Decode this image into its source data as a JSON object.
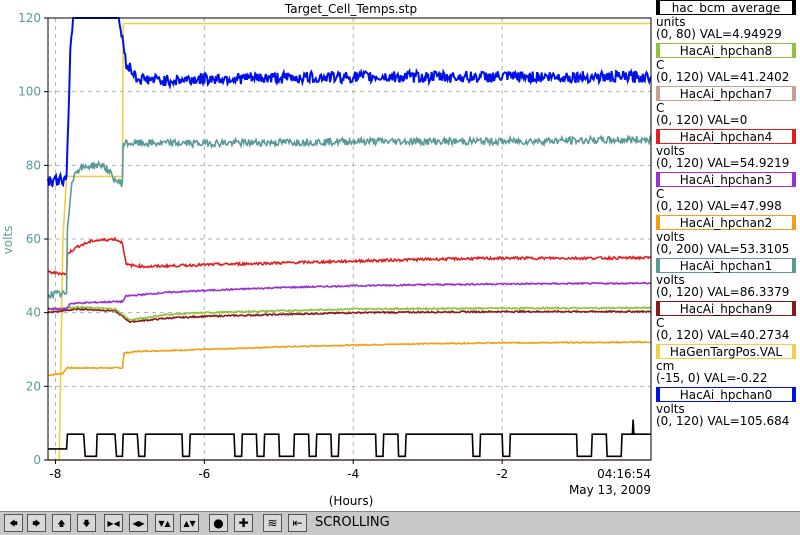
{
  "chart_data": {
    "type": "line",
    "title": "Target_Cell_Temps.stp",
    "xlabel": "(Hours)",
    "ylabel": "volts",
    "xlim": [
      -8.1,
      0.0
    ],
    "ylim": [
      0,
      120
    ],
    "x_ticks": [
      -8,
      -6,
      -4,
      -2
    ],
    "y_ticks": [
      0,
      20,
      40,
      60,
      80,
      100,
      120
    ],
    "grid": true,
    "time_label": "04:16:54",
    "date_label": "May 13, 2009",
    "series": [
      {
        "name": "hac_bcm_average",
        "color": "#000000",
        "unit": "units",
        "range": "(0, 80)",
        "value": "VAL=4.94929",
        "points": [
          [
            -8.1,
            3
          ],
          [
            -7.85,
            3
          ],
          [
            -7.84,
            7
          ],
          [
            -7.62,
            7
          ],
          [
            -7.6,
            1
          ],
          [
            -7.45,
            1
          ],
          [
            -7.44,
            7
          ],
          [
            -7.2,
            7
          ],
          [
            -7.18,
            1
          ],
          [
            -7.1,
            1
          ],
          [
            -7.09,
            7
          ],
          [
            -6.9,
            7
          ],
          [
            -6.88,
            1
          ],
          [
            -6.8,
            1
          ],
          [
            -6.79,
            7
          ],
          [
            -6.3,
            7
          ],
          [
            -6.29,
            1
          ],
          [
            -6.2,
            1
          ],
          [
            -6.19,
            7
          ],
          [
            -5.6,
            7
          ],
          [
            -5.59,
            1
          ],
          [
            -5.5,
            1
          ],
          [
            -5.49,
            7
          ],
          [
            -5.3,
            7
          ],
          [
            -5.29,
            1
          ],
          [
            -5.2,
            1
          ],
          [
            -5.19,
            7
          ],
          [
            -5.0,
            7
          ],
          [
            -4.99,
            1
          ],
          [
            -4.8,
            1
          ],
          [
            -4.79,
            7
          ],
          [
            -4.6,
            7
          ],
          [
            -4.59,
            1
          ],
          [
            -4.5,
            1
          ],
          [
            -4.49,
            7
          ],
          [
            -4.3,
            7
          ],
          [
            -4.29,
            1
          ],
          [
            -4.2,
            1
          ],
          [
            -4.19,
            7
          ],
          [
            -3.7,
            7
          ],
          [
            -3.69,
            1
          ],
          [
            -3.6,
            1
          ],
          [
            -3.59,
            7
          ],
          [
            -3.4,
            7
          ],
          [
            -3.39,
            1
          ],
          [
            -3.3,
            1
          ],
          [
            -3.29,
            7
          ],
          [
            -2.4,
            7
          ],
          [
            -2.39,
            1
          ],
          [
            -2.3,
            1
          ],
          [
            -2.29,
            7
          ],
          [
            -2.0,
            7
          ],
          [
            -1.99,
            1
          ],
          [
            -1.9,
            1
          ],
          [
            -1.89,
            7
          ],
          [
            -1.0,
            7
          ],
          [
            -0.99,
            1
          ],
          [
            -0.8,
            1
          ],
          [
            -0.79,
            7
          ],
          [
            -0.6,
            7
          ],
          [
            -0.59,
            1
          ],
          [
            -0.4,
            1
          ],
          [
            -0.39,
            7
          ],
          [
            -0.25,
            7
          ],
          [
            -0.24,
            11
          ],
          [
            -0.23,
            7
          ],
          [
            0.0,
            7
          ]
        ]
      },
      {
        "name": "HacAi_hpchan8",
        "color": "#8fc23a",
        "unit": "C",
        "range": "(0, 120)",
        "value": "VAL=41.2402",
        "points": [
          [
            -8.1,
            41
          ],
          [
            -7.7,
            41.5
          ],
          [
            -7.2,
            41
          ],
          [
            -7.0,
            38
          ],
          [
            -6.5,
            39.5
          ],
          [
            -6,
            40
          ],
          [
            -4,
            41
          ],
          [
            -2,
            41.2
          ],
          [
            0,
            41.3
          ]
        ]
      },
      {
        "name": "HacAi_hpchan7",
        "color": "#c9a090",
        "unit": "C",
        "range": "(0, 120)",
        "value": "VAL=0",
        "points": [
          [
            -8.1,
            0
          ],
          [
            0,
            0
          ]
        ]
      },
      {
        "name": "HacAi_hpchan4",
        "color": "#e02020",
        "unit": "volts",
        "range": "(0, 120)",
        "value": "VAL=54.9219",
        "points": [
          [
            -8.1,
            51
          ],
          [
            -7.85,
            50.5
          ],
          [
            -7.84,
            56
          ],
          [
            -7.7,
            58
          ],
          [
            -7.5,
            59.5
          ],
          [
            -7.2,
            60
          ],
          [
            -7.1,
            59
          ],
          [
            -7.05,
            53
          ],
          [
            -6.8,
            52.5
          ],
          [
            -6,
            53
          ],
          [
            -5,
            53.5
          ],
          [
            -4,
            54
          ],
          [
            -3,
            54.5
          ],
          [
            -2,
            54.8
          ],
          [
            -1,
            54.8
          ],
          [
            0,
            54.9
          ]
        ]
      },
      {
        "name": "HacAi_hpchan3",
        "color": "#9a30d0",
        "unit": "C",
        "range": "(0, 120)",
        "value": "VAL=47.998",
        "points": [
          [
            -8.1,
            41
          ],
          [
            -7.85,
            41
          ],
          [
            -7.8,
            42.5
          ],
          [
            -7.2,
            43
          ],
          [
            -7.1,
            43
          ],
          [
            -7.05,
            44.5
          ],
          [
            -6.5,
            45.5
          ],
          [
            -6,
            46
          ],
          [
            -5,
            46.8
          ],
          [
            -4,
            47.3
          ],
          [
            -3,
            47.6
          ],
          [
            -2,
            47.8
          ],
          [
            0,
            48
          ]
        ]
      },
      {
        "name": "HacAi_hpchan2",
        "color": "#f0a010",
        "unit": "volts",
        "range": "(0, 200)",
        "value": "VAL=53.3105",
        "points": [
          [
            -8.1,
            23
          ],
          [
            -7.9,
            23.5
          ],
          [
            -7.85,
            25
          ],
          [
            -7.2,
            25
          ],
          [
            -7.1,
            25
          ],
          [
            -7.08,
            29
          ],
          [
            -6.9,
            29.5
          ],
          [
            -6,
            30
          ],
          [
            -5,
            30.7
          ],
          [
            -4,
            31.2
          ],
          [
            -3,
            31.6
          ],
          [
            -2,
            31.8
          ],
          [
            0,
            32
          ]
        ]
      },
      {
        "name": "HacAi_hpchan1",
        "color": "#5a9a96",
        "unit": "volts",
        "range": "(0, 120)",
        "value": "VAL=86.3379",
        "points": [
          [
            -8.1,
            45
          ],
          [
            -7.85,
            45
          ],
          [
            -7.84,
            62
          ],
          [
            -7.78,
            76
          ],
          [
            -7.7,
            79
          ],
          [
            -7.5,
            80
          ],
          [
            -7.35,
            80
          ],
          [
            -7.2,
            76
          ],
          [
            -7.1,
            75
          ],
          [
            -7.09,
            86
          ],
          [
            -6.8,
            86
          ],
          [
            -6,
            86
          ],
          [
            -4,
            86.5
          ],
          [
            -2,
            86.5
          ],
          [
            0,
            87
          ]
        ]
      },
      {
        "name": "HacAi_hpchan9",
        "color": "#8a1a1a",
        "unit": "C",
        "range": "(0, 120)",
        "value": "VAL=40.2734",
        "points": [
          [
            -8.1,
            40
          ],
          [
            -7.7,
            41
          ],
          [
            -7.2,
            40.5
          ],
          [
            -7.0,
            37.5
          ],
          [
            -6.5,
            38.5
          ],
          [
            -6,
            39
          ],
          [
            -4,
            40
          ],
          [
            -2,
            40.3
          ],
          [
            0,
            40.3
          ]
        ]
      },
      {
        "name": "HaGenTargPos.VAL",
        "color": "#f0d040",
        "unit": "cm",
        "range": "(-15, 0)",
        "value": "VAL=-0.22",
        "points": [
          [
            -8.1,
            0
          ],
          [
            -7.95,
            0
          ],
          [
            -7.9,
            60
          ],
          [
            -7.85,
            77
          ],
          [
            -7.2,
            77
          ],
          [
            -7.1,
            77
          ],
          [
            -7.09,
            118
          ],
          [
            -7.08,
            118.5
          ],
          [
            0,
            118.5
          ]
        ]
      },
      {
        "name": "HacAi_hpchan0",
        "color": "#0010e8",
        "unit": "volts",
        "range": "(0, 120)",
        "value": "VAL=105.684",
        "points": [
          [
            -8.1,
            76
          ],
          [
            -7.85,
            76
          ],
          [
            -7.8,
            110
          ],
          [
            -7.75,
            125
          ],
          [
            -7.2,
            125
          ],
          [
            -7.15,
            120
          ],
          [
            -7.05,
            108
          ],
          [
            -6.9,
            103.5
          ],
          [
            -6.5,
            103
          ],
          [
            -6,
            103.5
          ],
          [
            -4,
            104
          ],
          [
            -2,
            104
          ],
          [
            -1,
            104
          ],
          [
            0,
            104
          ]
        ]
      }
    ]
  },
  "legend_items": [
    {
      "name": "hac_bcm_average",
      "unit": "units",
      "range_value": "(0, 80) VAL=4.94929",
      "box_color": "#000000"
    },
    {
      "name": "HacAi_hpchan8",
      "unit": "C",
      "range_value": "(0, 120) VAL=41.2402",
      "box_color": "#8fc23a"
    },
    {
      "name": "HacAi_hpchan7",
      "unit": "C",
      "range_value": "(0, 120) VAL=0",
      "box_color": "#c9a090"
    },
    {
      "name": "HacAi_hpchan4",
      "unit": "volts",
      "range_value": "(0, 120) VAL=54.9219",
      "box_color": "#e02020"
    },
    {
      "name": "HacAi_hpchan3",
      "unit": "C",
      "range_value": "(0, 120) VAL=47.998",
      "box_color": "#9a30d0"
    },
    {
      "name": "HacAi_hpchan2",
      "unit": "volts",
      "range_value": "(0, 200) VAL=53.3105",
      "box_color": "#f0a010"
    },
    {
      "name": "HacAi_hpchan1",
      "unit": "volts",
      "range_value": "(0, 120) VAL=86.3379",
      "box_color": "#5a9a96"
    },
    {
      "name": "HacAi_hpchan9",
      "unit": "C",
      "range_value": "(0, 120) VAL=40.2734",
      "box_color": "#8a1a1a"
    },
    {
      "name": "HaGenTargPos.VAL",
      "unit": "cm",
      "range_value": "(-15, 0) VAL=-0.22",
      "box_color": "#f0d040"
    },
    {
      "name": "HacAi_hpchan0",
      "unit": "volts",
      "range_value": "(0, 120) VAL=105.684",
      "box_color": "#0010e8"
    }
  ],
  "toolbar": {
    "status": "SCROLLING",
    "buttons": [
      {
        "icon": "arrow-left-icon",
        "glyph": "🡄"
      },
      {
        "icon": "arrow-right-icon",
        "glyph": "🡆"
      },
      {
        "icon": "arrow-up-icon",
        "glyph": "🡅"
      },
      {
        "icon": "arrow-down-icon",
        "glyph": "🡇"
      },
      {
        "icon": "zoom-in-horizontal-icon",
        "glyph": "▶◀"
      },
      {
        "icon": "zoom-out-horizontal-icon",
        "glyph": "◀▶"
      },
      {
        "icon": "zoom-in-vertical-icon",
        "glyph": "▼▲"
      },
      {
        "icon": "zoom-out-vertical-icon",
        "glyph": "▲▼"
      },
      {
        "icon": "record-icon",
        "glyph": "●"
      },
      {
        "icon": "plus-icon",
        "glyph": "✚"
      },
      {
        "icon": "autoscale-icon",
        "glyph": "≋"
      },
      {
        "icon": "scroll-mode-icon",
        "glyph": "⇤"
      }
    ]
  },
  "colors": {
    "axis_label": "#5a9a96",
    "grid": "#b0b0b0"
  }
}
